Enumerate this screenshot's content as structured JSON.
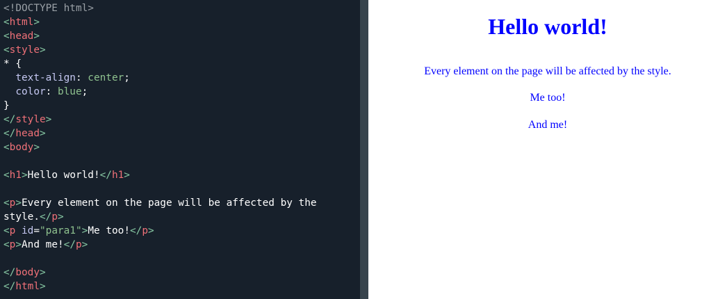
{
  "editor": {
    "lines": [
      [
        [
          "doctype",
          "<!DOCTYPE html>"
        ]
      ],
      [
        [
          "bracket",
          "<"
        ],
        [
          "tag",
          "html"
        ],
        [
          "bracket",
          ">"
        ]
      ],
      [
        [
          "bracket",
          "<"
        ],
        [
          "tag",
          "head"
        ],
        [
          "bracket",
          ">"
        ]
      ],
      [
        [
          "bracket",
          "<"
        ],
        [
          "tag",
          "style"
        ],
        [
          "bracket",
          ">"
        ]
      ],
      [
        [
          "text",
          "* {"
        ]
      ],
      [
        [
          "text",
          "  "
        ],
        [
          "prop",
          "text-align"
        ],
        [
          "text",
          ": "
        ],
        [
          "value",
          "center"
        ],
        [
          "text",
          ";"
        ]
      ],
      [
        [
          "text",
          "  "
        ],
        [
          "prop",
          "color"
        ],
        [
          "text",
          ": "
        ],
        [
          "value",
          "blue"
        ],
        [
          "text",
          ";"
        ]
      ],
      [
        [
          "text",
          "}"
        ]
      ],
      [
        [
          "bracket",
          "</"
        ],
        [
          "tag",
          "style"
        ],
        [
          "bracket",
          ">"
        ]
      ],
      [
        [
          "bracket",
          "</"
        ],
        [
          "tag",
          "head"
        ],
        [
          "bracket",
          ">"
        ]
      ],
      [
        [
          "bracket",
          "<"
        ],
        [
          "tag",
          "body"
        ],
        [
          "bracket",
          ">"
        ]
      ],
      [],
      [
        [
          "bracket",
          "<"
        ],
        [
          "tag",
          "h1"
        ],
        [
          "bracket",
          ">"
        ],
        [
          "text",
          "Hello world!"
        ],
        [
          "bracket",
          "</"
        ],
        [
          "tag",
          "h1"
        ],
        [
          "bracket",
          ">"
        ]
      ],
      [],
      [
        [
          "bracket",
          "<"
        ],
        [
          "tag",
          "p"
        ],
        [
          "bracket",
          ">"
        ],
        [
          "text",
          "Every element on the page will be affected by the"
        ]
      ],
      [
        [
          "text",
          "style."
        ],
        [
          "bracket",
          "</"
        ],
        [
          "tag",
          "p"
        ],
        [
          "bracket",
          ">"
        ]
      ],
      [
        [
          "bracket",
          "<"
        ],
        [
          "tag",
          "p"
        ],
        [
          "text",
          " "
        ],
        [
          "attr",
          "id"
        ],
        [
          "text",
          "="
        ],
        [
          "value",
          "\"para1\""
        ],
        [
          "bracket",
          ">"
        ],
        [
          "text",
          "Me too!"
        ],
        [
          "bracket",
          "</"
        ],
        [
          "tag",
          "p"
        ],
        [
          "bracket",
          ">"
        ]
      ],
      [
        [
          "bracket",
          "<"
        ],
        [
          "tag",
          "p"
        ],
        [
          "bracket",
          ">"
        ],
        [
          "text",
          "And me!"
        ],
        [
          "bracket",
          "</"
        ],
        [
          "tag",
          "p"
        ],
        [
          "bracket",
          ">"
        ]
      ],
      [],
      [
        [
          "bracket",
          "</"
        ],
        [
          "tag",
          "body"
        ],
        [
          "bracket",
          ">"
        ]
      ],
      [
        [
          "bracket",
          "</"
        ],
        [
          "tag",
          "html"
        ],
        [
          "bracket",
          ">"
        ]
      ]
    ]
  },
  "preview": {
    "heading": "Hello world!",
    "paragraphs": [
      "Every element on the page will be affected by the style.",
      "Me too!",
      "And me!"
    ],
    "text_color": "#0000ff"
  }
}
